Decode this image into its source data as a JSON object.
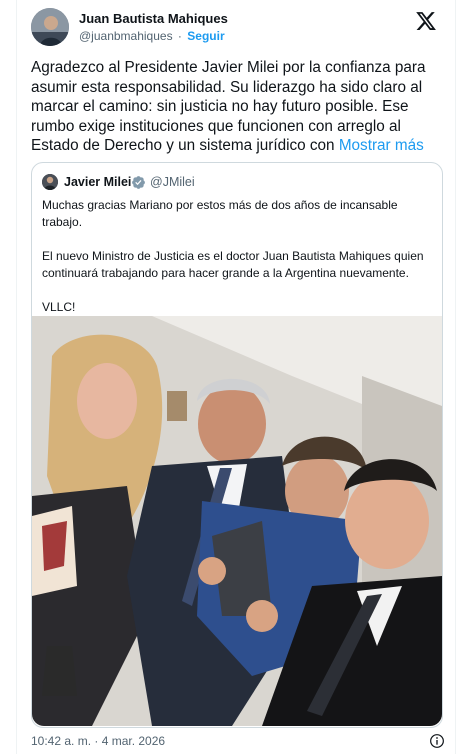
{
  "author": {
    "name": "Juan Bautista Mahiques",
    "handle": "@juanbmahiques",
    "separator": "·",
    "follow_label": "Seguir"
  },
  "tweet": {
    "text": "Agradezco al Presidente Javier Milei por la confianza para asumir esta responsabilidad. Su liderazgo ha sido claro al marcar el camino: sin justicia no hay futuro posible. Ese rumbo exige instituciones que funcionen con arreglo al Estado de Derecho y un sistema jurídico con",
    "show_more": "Mostrar más"
  },
  "quote": {
    "name": "Javier Milei",
    "handle": "@JMilei",
    "paragraphs": [
      "Muchas gracias Mariano por estos más de dos años de incansable trabajo.",
      "El nuevo Ministro de Justicia es el doctor Juan Bautista Mahiques quien continuará trabajando para hacer grande a la Argentina nuevamente.",
      "VLLC!"
    ]
  },
  "footer": {
    "timestamp": "10:42 a. m. · 4 mar. 2026"
  },
  "icons": {
    "brand": "x-logo-icon",
    "verified": "verified-badge-icon",
    "info": "info-icon"
  },
  "colors": {
    "accent": "#1d9bf0",
    "text": "#0f1419",
    "muted": "#536471",
    "border": "#cfd9de"
  }
}
